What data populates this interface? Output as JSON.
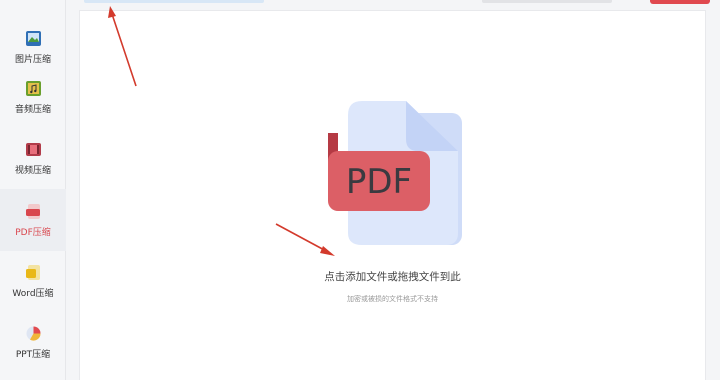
{
  "sidebar": {
    "items": [
      {
        "label": "图片压缩",
        "icon": "image-icon"
      },
      {
        "label": "音频压缩",
        "icon": "music-icon"
      },
      {
        "label": "视频压缩",
        "icon": "video-icon"
      },
      {
        "label": "PDF压缩",
        "icon": "pdf-icon",
        "active": true
      },
      {
        "label": "Word压缩",
        "icon": "word-icon"
      },
      {
        "label": "PPT压缩",
        "icon": "ppt-icon"
      }
    ]
  },
  "main": {
    "file_icon_text": "PDF",
    "drop_hint": "点击添加文件或拖拽文件到此",
    "sub_hint": "加密或被损的文件格式不支持"
  },
  "colors": {
    "accent": "#d9464d",
    "pdf_badge": "#dc5f66",
    "doc_body": "#dde7fb"
  }
}
